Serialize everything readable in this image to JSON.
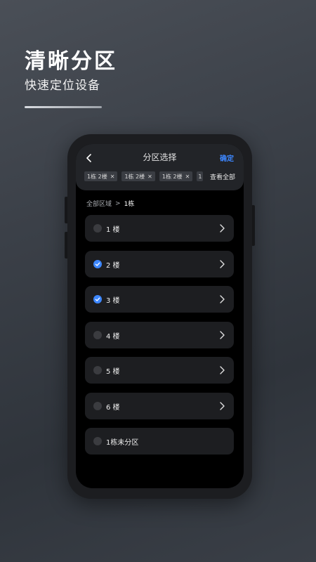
{
  "promo": {
    "title": "清晰分区",
    "subtitle": "快速定位设备"
  },
  "appbar": {
    "title": "分区选择",
    "confirm_label": "确定",
    "back_icon": "chevron-left-icon"
  },
  "chips": [
    {
      "label": "1栋 2楼"
    },
    {
      "label": "1栋 2楼"
    },
    {
      "label": "1栋 2楼"
    },
    {
      "label": "1"
    }
  ],
  "chip_remove_glyph": "✕",
  "view_all_label": "查看全部",
  "breadcrumb": {
    "root": "全部区域",
    "separator": ">",
    "current": "1栋"
  },
  "floors": [
    {
      "label": "1 楼",
      "checked": false,
      "has_children": true
    },
    {
      "label": "2 楼",
      "checked": true,
      "has_children": true
    },
    {
      "label": "3 楼",
      "checked": true,
      "has_children": true
    },
    {
      "label": "4 楼",
      "checked": false,
      "has_children": true
    },
    {
      "label": "5 楼",
      "checked": false,
      "has_children": true
    },
    {
      "label": "6 楼",
      "checked": false,
      "has_children": true
    },
    {
      "label": "1栋未分区",
      "checked": false,
      "has_children": false
    }
  ],
  "colors": {
    "accent": "#3d87ff",
    "row_bg": "#1d1e21",
    "screen_bg": "#000000"
  }
}
